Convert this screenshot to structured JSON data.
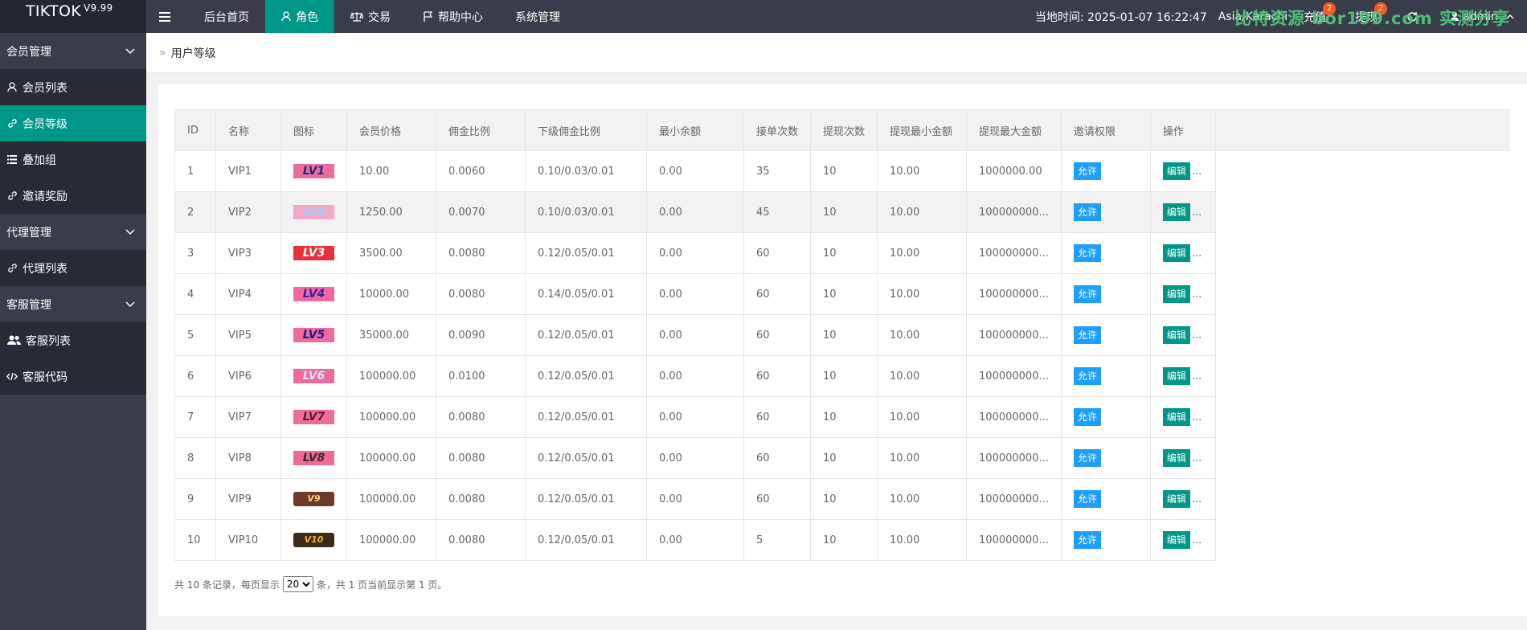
{
  "app": {
    "title": "TIKTOK",
    "version": "V9.99"
  },
  "topnav": {
    "items": [
      {
        "label": "后台首页"
      },
      {
        "label": "角色"
      },
      {
        "label": "交易"
      },
      {
        "label": "帮助中心"
      },
      {
        "label": "系统管理"
      }
    ]
  },
  "topright": {
    "time": "当地时间: 2025-01-07 16:22:47",
    "timezone": "Asia/Karachi",
    "recharge": "充值",
    "recharge_badge": "2",
    "withdraw": "提现",
    "withdraw_badge": "2",
    "user": "admin"
  },
  "watermark": "比特资源 bor199.com 实测分享",
  "sidebar": {
    "groups": [
      {
        "label": "会员管理",
        "items": [
          {
            "label": "会员列表"
          },
          {
            "label": "会员等级"
          },
          {
            "label": "叠加组"
          },
          {
            "label": "邀请奖励"
          }
        ]
      },
      {
        "label": "代理管理",
        "items": [
          {
            "label": "代理列表"
          }
        ]
      },
      {
        "label": "客服管理",
        "items": [
          {
            "label": "客服列表"
          },
          {
            "label": "客服代码"
          }
        ]
      }
    ]
  },
  "breadcrumb": "用户等级",
  "table": {
    "headers": [
      "ID",
      "名称",
      "图标",
      "会员价格",
      "佣金比例",
      "下级佣金比例",
      "最小余额",
      "接单次数",
      "提现次数",
      "提现最小金额",
      "提现最大金额",
      "邀请权限",
      "操作"
    ],
    "allow_label": "允许",
    "edit_label": "编辑",
    "more_label": "...",
    "rows": [
      {
        "id": "1",
        "name": "VIP1",
        "icon": "LV1",
        "price": "10.00",
        "rate": "0.0060",
        "sub_rate": "0.10/0.03/0.01",
        "min_balance": "0.00",
        "orders": "35",
        "withdraw_times": "10",
        "wd_min": "10.00",
        "wd_max": "1000000.00"
      },
      {
        "id": "2",
        "name": "VIP2",
        "icon": "LV2",
        "price": "1250.00",
        "rate": "0.0070",
        "sub_rate": "0.10/0.03/0.01",
        "min_balance": "0.00",
        "orders": "45",
        "withdraw_times": "10",
        "wd_min": "10.00",
        "wd_max": "100000000..."
      },
      {
        "id": "3",
        "name": "VIP3",
        "icon": "LV3",
        "price": "3500.00",
        "rate": "0.0080",
        "sub_rate": "0.12/0.05/0.01",
        "min_balance": "0.00",
        "orders": "60",
        "withdraw_times": "10",
        "wd_min": "10.00",
        "wd_max": "100000000..."
      },
      {
        "id": "4",
        "name": "VIP4",
        "icon": "LV4",
        "price": "10000.00",
        "rate": "0.0080",
        "sub_rate": "0.14/0.05/0.01",
        "min_balance": "0.00",
        "orders": "60",
        "withdraw_times": "10",
        "wd_min": "10.00",
        "wd_max": "100000000..."
      },
      {
        "id": "5",
        "name": "VIP5",
        "icon": "LV5",
        "price": "35000.00",
        "rate": "0.0090",
        "sub_rate": "0.12/0.05/0.01",
        "min_balance": "0.00",
        "orders": "60",
        "withdraw_times": "10",
        "wd_min": "10.00",
        "wd_max": "100000000..."
      },
      {
        "id": "6",
        "name": "VIP6",
        "icon": "LV6",
        "price": "100000.00",
        "rate": "0.0100",
        "sub_rate": "0.12/0.05/0.01",
        "min_balance": "0.00",
        "orders": "60",
        "withdraw_times": "10",
        "wd_min": "10.00",
        "wd_max": "100000000..."
      },
      {
        "id": "7",
        "name": "VIP7",
        "icon": "LV7",
        "price": "100000.00",
        "rate": "0.0080",
        "sub_rate": "0.12/0.05/0.01",
        "min_balance": "0.00",
        "orders": "60",
        "withdraw_times": "10",
        "wd_min": "10.00",
        "wd_max": "100000000..."
      },
      {
        "id": "8",
        "name": "VIP8",
        "icon": "LV8",
        "price": "100000.00",
        "rate": "0.0080",
        "sub_rate": "0.12/0.05/0.01",
        "min_balance": "0.00",
        "orders": "60",
        "withdraw_times": "10",
        "wd_min": "10.00",
        "wd_max": "100000000..."
      },
      {
        "id": "9",
        "name": "VIP9",
        "icon": "V9",
        "price": "100000.00",
        "rate": "0.0080",
        "sub_rate": "0.12/0.05/0.01",
        "min_balance": "0.00",
        "orders": "60",
        "withdraw_times": "10",
        "wd_min": "10.00",
        "wd_max": "100000000..."
      },
      {
        "id": "10",
        "name": "VIP10",
        "icon": "V10",
        "price": "100000.00",
        "rate": "0.0080",
        "sub_rate": "0.12/0.05/0.01",
        "min_balance": "0.00",
        "orders": "5",
        "withdraw_times": "10",
        "wd_min": "10.00",
        "wd_max": "100000000..."
      }
    ]
  },
  "pager": {
    "before": "共 10 条记录，每页显示",
    "page_size": "20",
    "after": "条，共 1 页当前显示第 1 页。"
  }
}
